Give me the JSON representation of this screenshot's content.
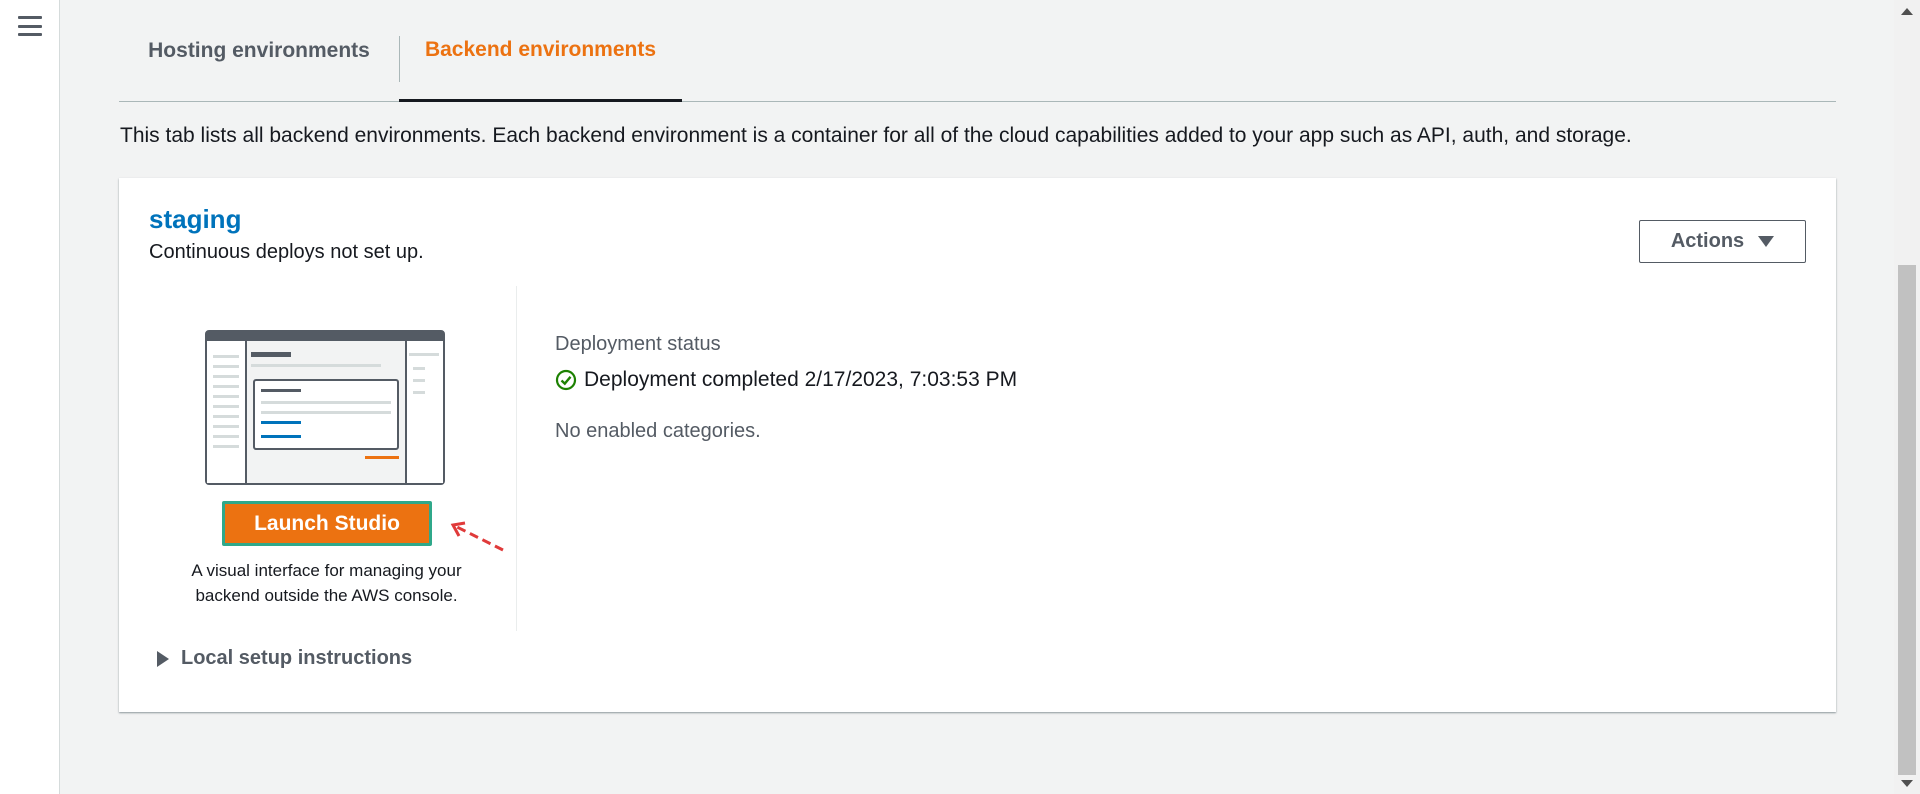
{
  "nav": {
    "menu_icon": "hamburger-menu-icon"
  },
  "tabs": [
    {
      "label": "Hosting environments",
      "active": false
    },
    {
      "label": "Backend environments",
      "active": true
    }
  ],
  "description": "This tab lists all backend environments. Each backend environment is a container for all of the cloud capabilities added to your app such as API, auth, and storage.",
  "environment": {
    "name": "staging",
    "subtitle": "Continuous deploys not set up.",
    "actions_label": "Actions",
    "studio": {
      "button_label": "Launch Studio",
      "description": "A visual interface for managing your backend outside the AWS console."
    },
    "deployment": {
      "label": "Deployment status",
      "status": "Deployment completed 2/17/2023, 7:03:53 PM",
      "status_icon": "check-circle-icon"
    },
    "categories_text": "No enabled categories.",
    "local_setup_label": "Local setup instructions"
  },
  "colors": {
    "accent": "#ec7211",
    "link": "#0073bb",
    "success": "#1d8102",
    "annotation": "#e03a3a"
  }
}
